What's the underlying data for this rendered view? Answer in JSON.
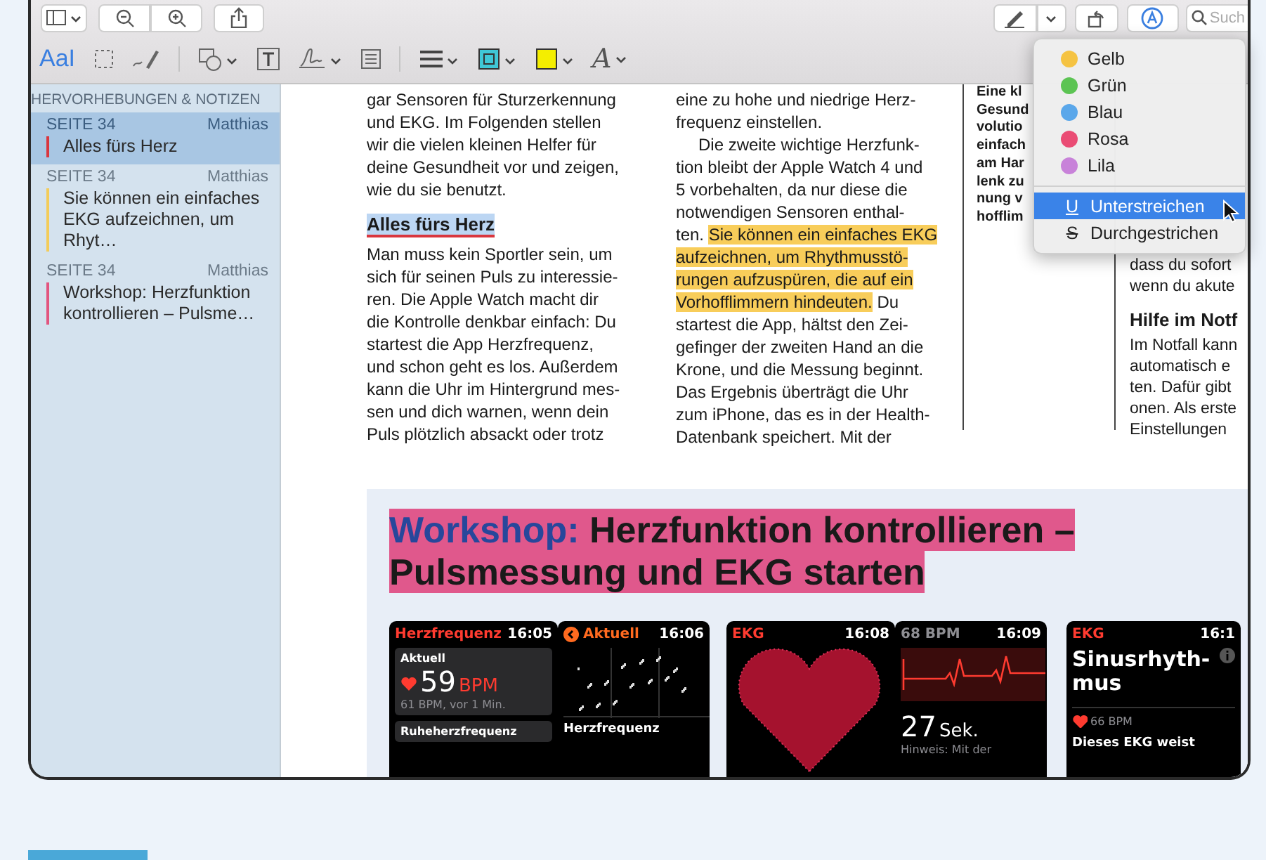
{
  "toolbar": {
    "text_tool_glyph": "AaI",
    "font_glyph": "A",
    "search_placeholder": "Such"
  },
  "sidebar": {
    "title": "HERVORHEBUNGEN & NOTIZEN",
    "items": [
      {
        "page": "SEITE 34",
        "author": "Matthias",
        "text": "Alles fürs Herz",
        "color": "#d9363e",
        "selected": true
      },
      {
        "page": "SEITE 34",
        "author": "Matthias",
        "text": "Sie können ein einfaches EKG aufzeichnen, um Rhyt…",
        "color": "#f3cc5a",
        "selected": false
      },
      {
        "page": "SEITE 34",
        "author": "Matthias",
        "text": "Workshop: Herzfunktion kontrollieren – Pulsme…",
        "color": "#e2557f",
        "selected": false
      }
    ]
  },
  "document": {
    "columns": [
      {
        "blocks": [
          {
            "kind": "paragraph",
            "lines": [
              "gar Sensoren für Sturzerkennung",
              "und EKG. Im Folgenden stellen",
              "wir die vielen kleinen Helfer für",
              "deine Gesundheit vor und zeigen,",
              "wie du sie benutzt."
            ]
          },
          {
            "kind": "heading",
            "text": "Alles fürs Herz",
            "highlighted": true
          },
          {
            "kind": "paragraph",
            "lines": [
              "Man muss kein Sportler sein, um",
              "sich für seinen Puls zu interessie-",
              "ren. Die Apple Watch macht dir",
              "die Kontrolle denkbar einfach: Du",
              "startest die App Herzfrequenz,",
              "und schon geht es los. Außerdem",
              "kann die Uhr im Hintergrund mes-",
              "sen und dich warnen, wenn dein",
              "Puls plötzlich absackt oder trotz"
            ]
          }
        ]
      },
      {
        "blocks": [
          {
            "kind": "paragraph",
            "lines": [
              "eine zu hohe und niedrige Herz-",
              "frequenz einstellen."
            ]
          },
          {
            "kind": "paragraph",
            "lines": [
              "Die zweite wichtige Herzfunk-",
              "tion bleibt der Apple Watch 4 und",
              "5 vorbehalten, da nur diese die",
              "notwendigen Sensoren enthal-",
              [
                {
                  "text": "ten. ",
                  "highlighted": false
                },
                {
                  "text": "Sie können ein einfaches EKG",
                  "highlighted": true
                }
              ],
              [
                {
                  "text": "aufzeichnen, um Rhythmusstö-",
                  "highlighted": true
                }
              ],
              [
                {
                  "text": "rungen aufzuspüren, die auf ein",
                  "highlighted": true
                }
              ],
              [
                {
                  "text": "Vorhofflimmern hindeuten.",
                  "highlighted": true
                },
                {
                  "text": " Du",
                  "highlighted": false
                }
              ],
              "startest die App, hältst den Zei-",
              "gefinger der zweiten Hand an die",
              "Krone, und die Messung beginnt.",
              "Das Ergebnis überträgt die Uhr",
              "zum iPhone, das es in der Health-",
              "Datenbank speichert. Mit der"
            ]
          }
        ]
      },
      {
        "blocks": [
          {
            "kind": "lead",
            "lines": [
              "Eine kl",
              "Gesund",
              "volutio",
              "einfach",
              "am Har",
              "lenk zu",
              "nung v",
              "hofflim"
            ]
          }
        ]
      },
      {
        "blocks": [
          {
            "kind": "paragraph",
            "lines": [
              "dass du sofort",
              "wenn du akute"
            ]
          },
          {
            "kind": "heading",
            "text": "Hilfe im Notf",
            "highlighted": false
          },
          {
            "kind": "paragraph",
            "lines": [
              "Im Notfall kann",
              "automatisch e",
              "ten. Dafür gibt",
              "onen. Als erste",
              "Einstellungen"
            ]
          }
        ]
      }
    ],
    "workshop": {
      "title_lead": "Workshop:",
      "title": "Herzfunktion kontrollieren – Pulsmessung und EKG starten",
      "highlighted": true,
      "screens": [
        {
          "kind": "heart_rate",
          "title": "Herzfrequenz",
          "time": "16:05",
          "label": "Aktuell",
          "value": "59",
          "unit": "BPM",
          "note": "61 BPM, vor 1 Min.",
          "footer": "Ruheherzfrequenz"
        },
        {
          "kind": "chart",
          "title": "Aktuell",
          "time": "16:06",
          "footer": "Herzfrequenz"
        },
        {
          "kind": "heart",
          "title": "EKG",
          "time": "16:08"
        },
        {
          "kind": "ecg",
          "title": "68 BPM",
          "time": "16:09",
          "value": "27",
          "unit": "Sek.",
          "note": "Hinweis: Mit der"
        },
        {
          "kind": "result",
          "title": "EKG",
          "time": "16:1",
          "label": "Sinusrhyth-\nmus",
          "value": "66 BPM",
          "note": "Dieses EKG weist"
        }
      ]
    }
  },
  "highlight_menu": {
    "colors": [
      {
        "label": "Gelb",
        "color": "#f5c342",
        "selected": false
      },
      {
        "label": "Grün",
        "color": "#5cc453",
        "selected": false
      },
      {
        "label": "Blau",
        "color": "#5aa7ea",
        "selected": false
      },
      {
        "label": "Rosa",
        "color": "#ea4c74",
        "selected": false
      },
      {
        "label": "Lila",
        "color": "#c882d9",
        "selected": false
      }
    ],
    "styles": [
      {
        "kind": "underline",
        "symbol": "U",
        "label": "Unterstreichen",
        "selected": true
      },
      {
        "kind": "strikethrough",
        "symbol": "S",
        "label": "Durchgestrichen",
        "selected": false
      }
    ]
  }
}
